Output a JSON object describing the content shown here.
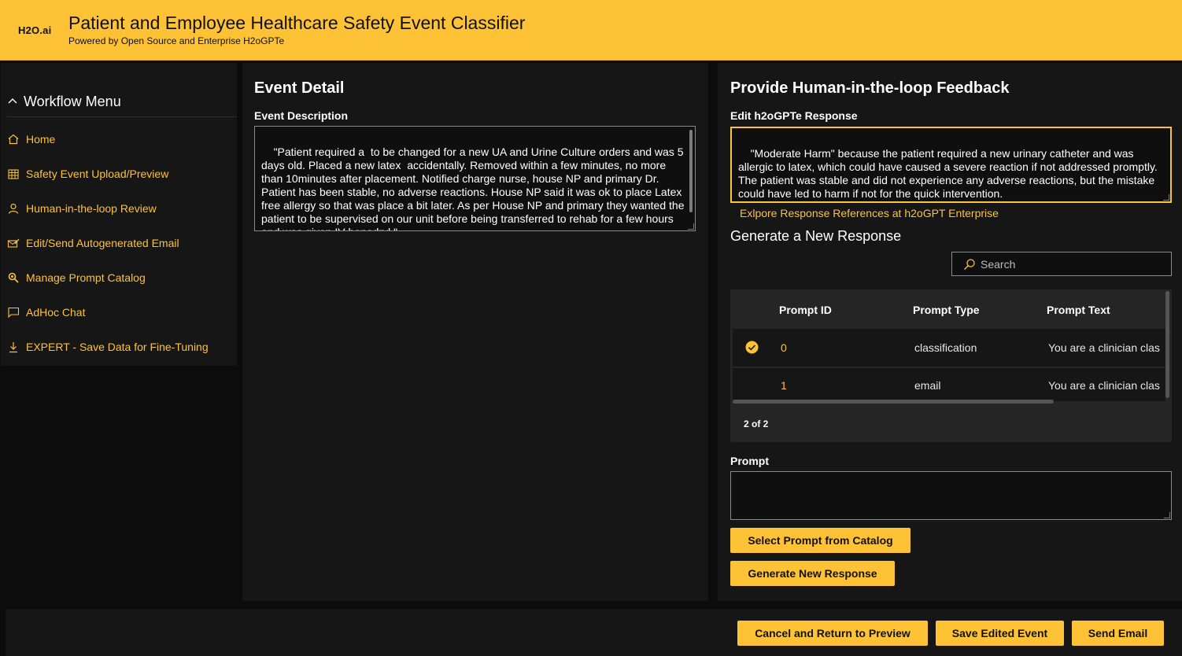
{
  "header": {
    "logo": "H2O.ai",
    "title": "Patient and Employee Healthcare Safety Event Classifier",
    "subtitle": "Powered by Open Source and Enterprise H2oGPTe"
  },
  "sidebar": {
    "menu_title": "Workflow Menu",
    "items": [
      {
        "label": "Home",
        "icon": "home-icon"
      },
      {
        "label": "Safety Event Upload/Preview",
        "icon": "table-icon"
      },
      {
        "label": "Human-in-the-loop Review",
        "icon": "person-icon"
      },
      {
        "label": "Edit/Send Autogenerated Email",
        "icon": "edit-mail-icon"
      },
      {
        "label": "Manage Prompt Catalog",
        "icon": "search-gear-icon"
      },
      {
        "label": "AdHoc Chat",
        "icon": "chat-icon"
      },
      {
        "label": "EXPERT - Save Data for Fine-Tuning",
        "icon": "download-icon"
      }
    ]
  },
  "event_detail": {
    "title": "Event Detail",
    "description_label": "Event Description",
    "description": "\"Patient required a  to be changed for a new UA and Urine Culture orders and was 5 days old. Placed a new latex  accidentally. Removed within a few minutes, no more than 10minutes after placement. Notified charge nurse, house NP and primary Dr. Patient has been stable, no adverse reactions. House NP said it was ok to place Latex free allergy so that was place a bit later. As per House NP and primary they wanted the patient to be supervised on our unit before being transferred to rehab for a few hours and was given IV benadryl \""
  },
  "feedback": {
    "title": "Provide Human-in-the-loop Feedback",
    "response_label": "Edit h2oGPTe Response",
    "response": "\"Moderate Harm\" because the patient required a new urinary catheter and was allergic to latex, which could have caused a severe reaction if not addressed promptly. The patient was stable and did not experience any adverse reactions, but the mistake could have led to harm if not for the quick intervention.",
    "references_link": "Exlpore Response References at h2oGPT Enterprise",
    "new_response_heading": "Generate a New Response",
    "search_placeholder": "Search",
    "table": {
      "columns": [
        "Prompt ID",
        "Prompt Type",
        "Prompt Text"
      ],
      "rows": [
        {
          "id": "0",
          "type": "classification",
          "text": "You are a clinician clas",
          "selected": true
        },
        {
          "id": "1",
          "type": "email",
          "text": "You are a clinician clas",
          "selected": false
        }
      ],
      "pager": "2 of 2"
    },
    "prompt_label": "Prompt",
    "prompt_value": "",
    "select_prompt_button": "Select Prompt from Catalog",
    "generate_button": "Generate New Response"
  },
  "footer": {
    "cancel_button": "Cancel and Return to Preview",
    "save_button": "Save Edited Event",
    "send_button": "Send Email"
  },
  "colors": {
    "accent": "#fec236",
    "background": "#0c0c0c",
    "panel": "#161616"
  }
}
